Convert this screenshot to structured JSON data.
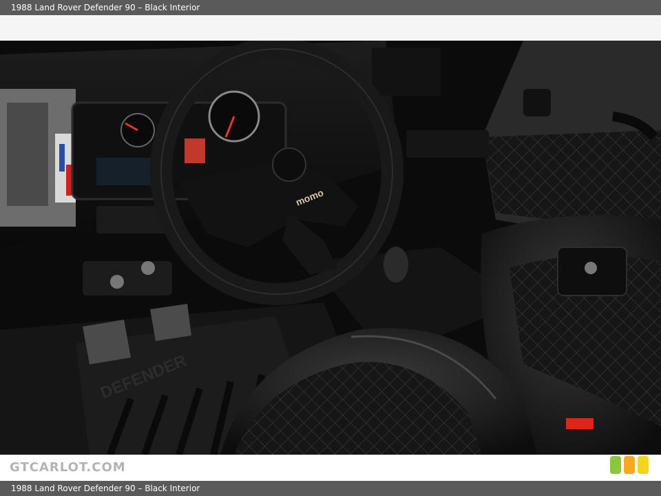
{
  "header": {
    "title": "1988 Land Rover Defender 90 – Black Interior"
  },
  "photo": {
    "steering_wheel_logo": "momo",
    "floor_mat_text": "DEFENDER"
  },
  "footer": {
    "watermark": "GTCARLOT.COM",
    "caption": "1988 Land Rover Defender 90 – Black Interior",
    "rating_colors": [
      "#8cc63f",
      "#f7a823",
      "#f5d31e"
    ]
  }
}
